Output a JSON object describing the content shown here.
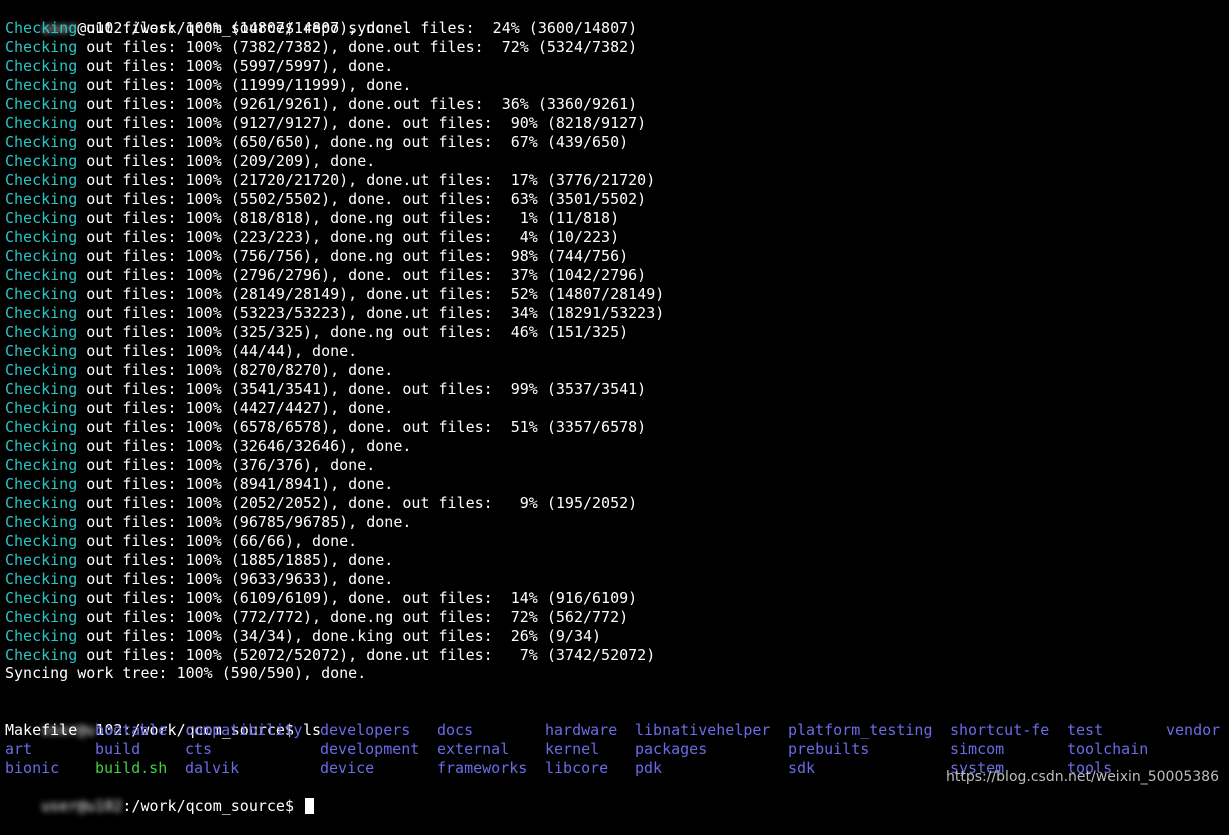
{
  "prompt1": {
    "user_masked": "user",
    "host_path": "@u102:/work/qcom_source$",
    "command": " repo sync -l"
  },
  "checking_word": "Checking",
  "sync_lines": [
    " out files: 100% (14807/14807), done. files:  24% (3600/14807)",
    " out files: 100% (7382/7382), done.out files:  72% (5324/7382)",
    " out files: 100% (5997/5997), done.",
    " out files: 100% (11999/11999), done.",
    " out files: 100% (9261/9261), done.out files:  36% (3360/9261)",
    " out files: 100% (9127/9127), done. out files:  90% (8218/9127)",
    " out files: 100% (650/650), done.ng out files:  67% (439/650)",
    " out files: 100% (209/209), done.",
    " out files: 100% (21720/21720), done.ut files:  17% (3776/21720)",
    " out files: 100% (5502/5502), done. out files:  63% (3501/5502)",
    " out files: 100% (818/818), done.ng out files:   1% (11/818)",
    " out files: 100% (223/223), done.ng out files:   4% (10/223)",
    " out files: 100% (756/756), done.ng out files:  98% (744/756)",
    " out files: 100% (2796/2796), done. out files:  37% (1042/2796)",
    " out files: 100% (28149/28149), done.ut files:  52% (14807/28149)",
    " out files: 100% (53223/53223), done.ut files:  34% (18291/53223)",
    " out files: 100% (325/325), done.ng out files:  46% (151/325)",
    " out files: 100% (44/44), done.",
    " out files: 100% (8270/8270), done.",
    " out files: 100% (3541/3541), done. out files:  99% (3537/3541)",
    " out files: 100% (4427/4427), done.",
    " out files: 100% (6578/6578), done. out files:  51% (3357/6578)",
    " out files: 100% (32646/32646), done.",
    " out files: 100% (376/376), done.",
    " out files: 100% (8941/8941), done.",
    " out files: 100% (2052/2052), done. out files:   9% (195/2052)",
    " out files: 100% (96785/96785), done.",
    " out files: 100% (66/66), done.",
    " out files: 100% (1885/1885), done.",
    " out files: 100% (9633/9633), done.",
    " out files: 100% (6109/6109), done. out files:  14% (916/6109)",
    " out files: 100% (772/772), done.ng out files:  72% (562/772)",
    " out files: 100% (34/34), done.king out files:  26% (9/34)",
    " out files: 100% (52072/52072), done.ut files:   7% (3742/52072)"
  ],
  "syncing_line": "Syncing work tree: 100% (590/590), done.",
  "prompt2": {
    "user_masked": "user@u",
    "host_path": "102:/work/qcom_source$",
    "command": " ls"
  },
  "ls_rows": [
    [
      {
        "name": "Makefile",
        "kind": "file"
      },
      {
        "name": "bootable",
        "kind": "dir"
      },
      {
        "name": "compatibility",
        "kind": "dir"
      },
      {
        "name": "developers",
        "kind": "dir"
      },
      {
        "name": "docs",
        "kind": "dir"
      },
      {
        "name": "hardware",
        "kind": "dir"
      },
      {
        "name": "libnativehelper",
        "kind": "dir"
      },
      {
        "name": "platform_testing",
        "kind": "dir"
      },
      {
        "name": "shortcut-fe",
        "kind": "dir"
      },
      {
        "name": "test",
        "kind": "dir"
      },
      {
        "name": "vendor",
        "kind": "dir"
      }
    ],
    [
      {
        "name": "art",
        "kind": "dir"
      },
      {
        "name": "build",
        "kind": "dir"
      },
      {
        "name": "cts",
        "kind": "dir"
      },
      {
        "name": "development",
        "kind": "dir"
      },
      {
        "name": "external",
        "kind": "dir"
      },
      {
        "name": "kernel",
        "kind": "dir"
      },
      {
        "name": "packages",
        "kind": "dir"
      },
      {
        "name": "prebuilts",
        "kind": "dir"
      },
      {
        "name": "simcom",
        "kind": "dir"
      },
      {
        "name": "toolchain",
        "kind": "dir"
      },
      {
        "name": "",
        "kind": "dir"
      }
    ],
    [
      {
        "name": "bionic",
        "kind": "dir"
      },
      {
        "name": "build.sh",
        "kind": "exec"
      },
      {
        "name": "dalvik",
        "kind": "dir"
      },
      {
        "name": "device",
        "kind": "dir"
      },
      {
        "name": "frameworks",
        "kind": "dir"
      },
      {
        "name": "libcore",
        "kind": "dir"
      },
      {
        "name": "pdk",
        "kind": "dir"
      },
      {
        "name": "sdk",
        "kind": "dir"
      },
      {
        "name": "system",
        "kind": "dir"
      },
      {
        "name": "tools",
        "kind": "dir"
      },
      {
        "name": "",
        "kind": "dir"
      }
    ]
  ],
  "prompt3": {
    "user_masked": "user@u102",
    "host_path": ":/work/qcom_source$",
    "command": " "
  },
  "watermark": "https://blog.csdn.net/weixin_50005386",
  "colors": {
    "background": "#000000",
    "checking": "#2bc4c4",
    "text": "#ffffff",
    "directory": "#6b6be8",
    "executable": "#3fd13f"
  }
}
